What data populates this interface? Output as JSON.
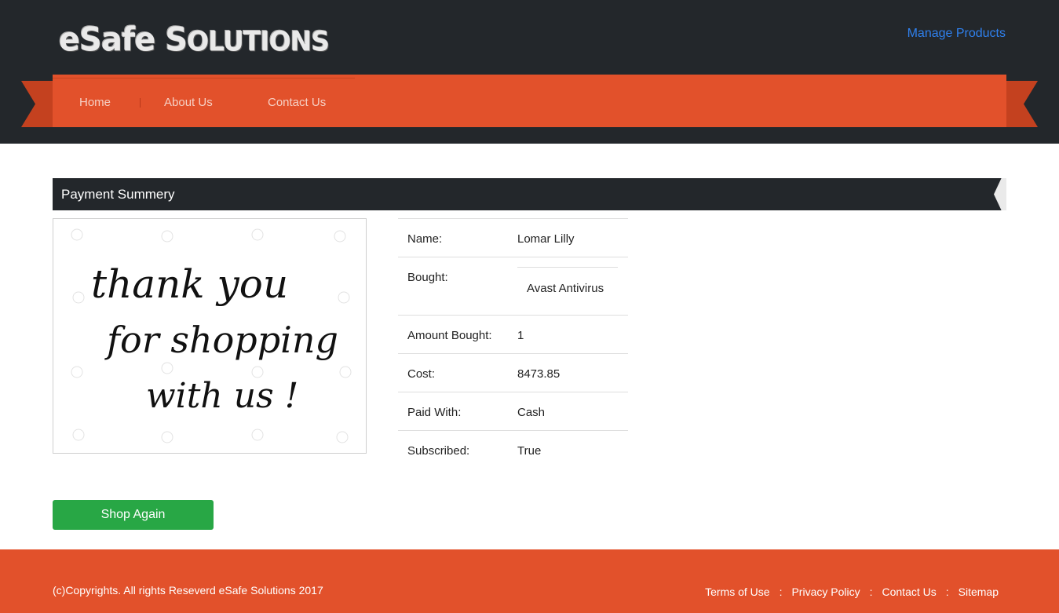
{
  "header": {
    "logo_text": "eSafe Solutions",
    "logo_part1": "eSafe ",
    "logo_part2_big": "S",
    "logo_part2_rest": "OLUTIONS",
    "manage_link": "Manage Products"
  },
  "nav": {
    "items": [
      {
        "label": "Home"
      },
      {
        "label": "About Us"
      },
      {
        "label": "Contact Us"
      }
    ]
  },
  "section": {
    "title": "Payment Summery"
  },
  "thanks_image": {
    "line1": "thank  you",
    "line2": "for  shopping",
    "line3": "with  us !"
  },
  "details": {
    "rows": [
      {
        "label": "Name:",
        "value": "Lomar Lilly"
      },
      {
        "label": "Bought:",
        "value": "Avast Antivirus"
      },
      {
        "label": "Amount Bought:",
        "value": "1"
      },
      {
        "label": "Cost:",
        "value": "8473.85"
      },
      {
        "label": "Paid With:",
        "value": "Cash"
      },
      {
        "label": "Subscribed:",
        "value": "True"
      }
    ]
  },
  "actions": {
    "shop_again": "Shop Again"
  },
  "footer": {
    "copyright": "(c)Copyrights. All rights Reseverd eSafe Solutions 2017",
    "links": [
      {
        "label": "Terms of Use"
      },
      {
        "label": "Privacy Policy"
      },
      {
        "label": "Contact Us"
      },
      {
        "label": "Sitemap"
      }
    ],
    "separator": ":"
  },
  "colors": {
    "header_bg": "#23272b",
    "accent_orange": "#e2512b",
    "link_blue": "#2f80ed",
    "button_green": "#28a745"
  }
}
